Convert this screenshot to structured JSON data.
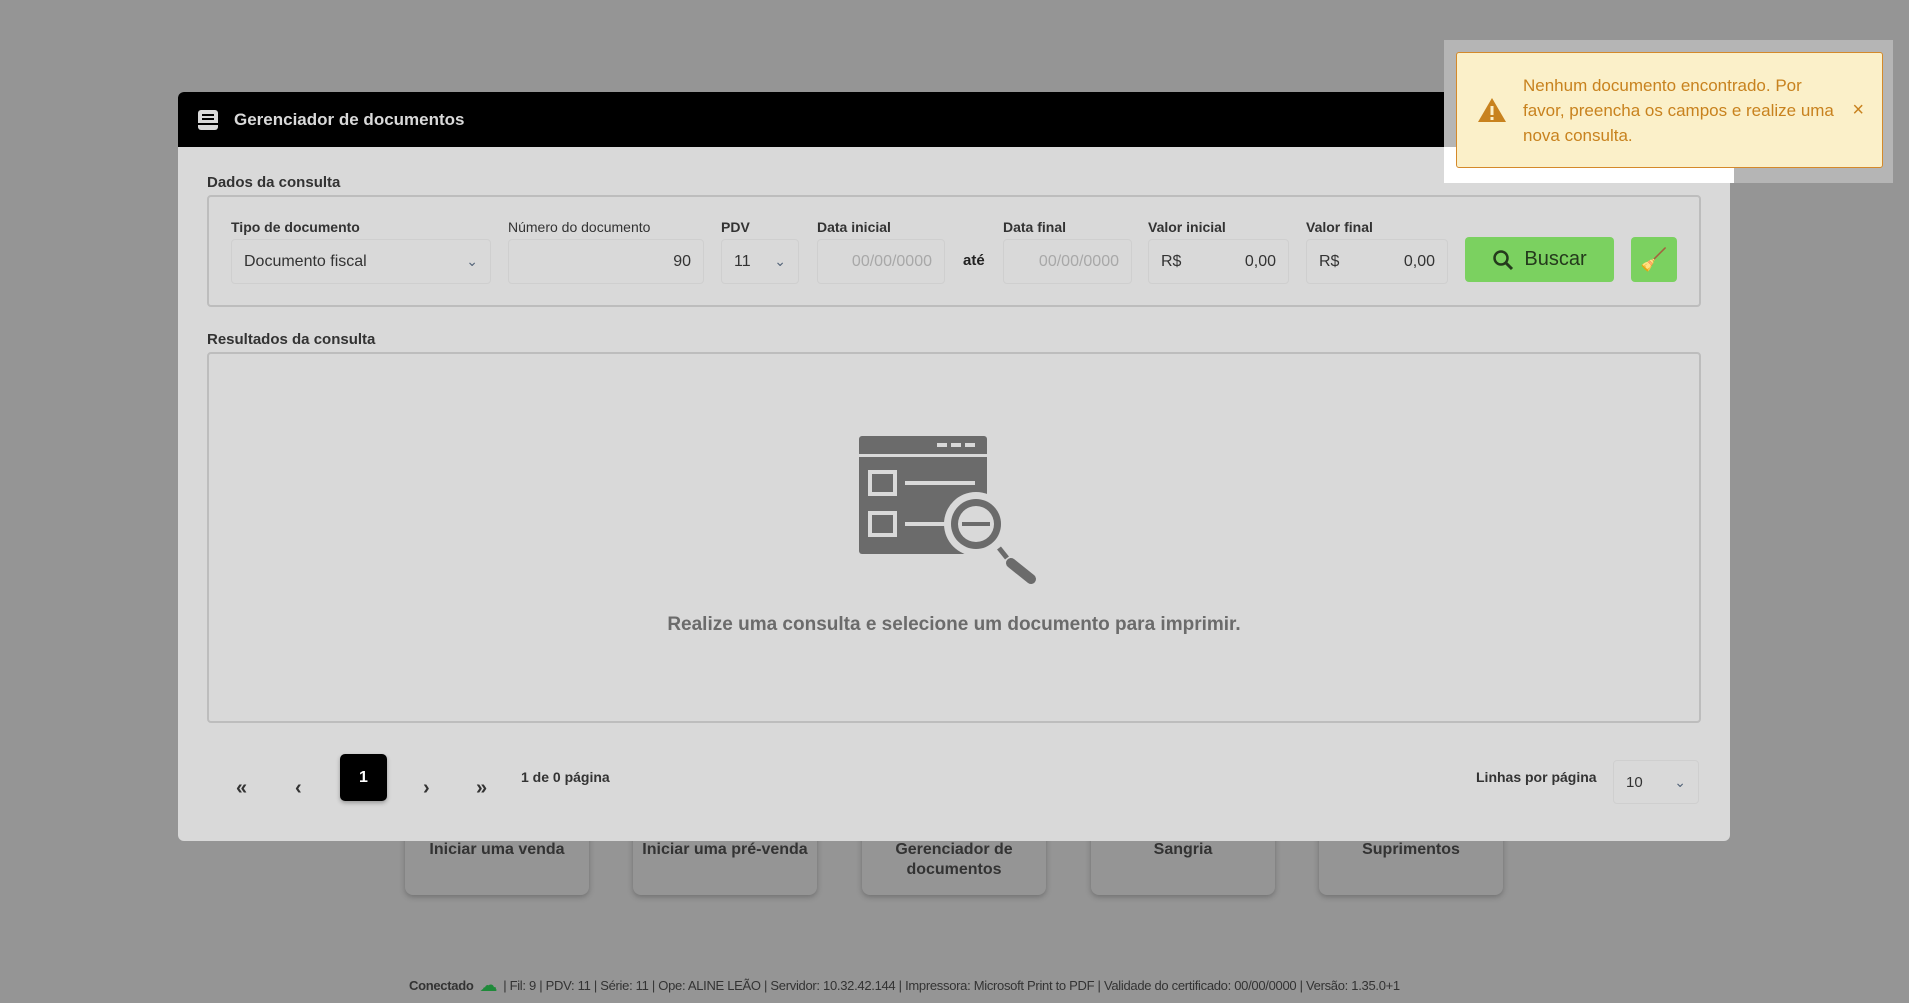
{
  "background": {
    "cards": [
      "Iniciar uma venda",
      "Iniciar uma pré-venda",
      "Gerenciador de documentos",
      "Sangria",
      "Suprimentos"
    ],
    "status": {
      "connected": "Conectado",
      "details": "| Fil: 9 | PDV: 11 | Série: 11 | Ope: ALINE LEÃO | Servidor: 10.32.42.144 | Impressora: Microsoft Print to PDF | Validade do certificado: 00/00/0000 | Versão: 1.35.0+1"
    }
  },
  "modal": {
    "title": "Gerenciador de documentos",
    "query_section": "Dados da consulta",
    "fields": {
      "doc_type": {
        "label": "Tipo de documento",
        "value": "Documento fiscal"
      },
      "doc_number": {
        "label": "Número do documento",
        "value": "90"
      },
      "pdv": {
        "label": "PDV",
        "value": "11"
      },
      "start_date": {
        "label": "Data inicial",
        "placeholder": "00/00/0000"
      },
      "between": "até",
      "end_date": {
        "label": "Data final",
        "placeholder": "00/00/0000"
      },
      "start_value": {
        "label": "Valor inicial",
        "prefix": "R$",
        "value": "0,00"
      },
      "end_value": {
        "label": "Valor final",
        "prefix": "R$",
        "value": "0,00"
      }
    },
    "search_button": "Buscar",
    "results_section": "Resultados da consulta",
    "empty_message": "Realize uma consulta e selecione um documento para imprimir.",
    "pagination": {
      "current_page": "1",
      "summary": "1 de 0 página",
      "rows_label": "Linhas por página",
      "rows_value": "10"
    }
  },
  "toast": {
    "message": "Nenhum documento encontrado. Por favor, preencha os campos e realize uma nova consulta.",
    "close": "×"
  },
  "colors": {
    "accent": "#7bd160",
    "warning": "#c8821e",
    "warning_bg": "#fbf0c9"
  }
}
